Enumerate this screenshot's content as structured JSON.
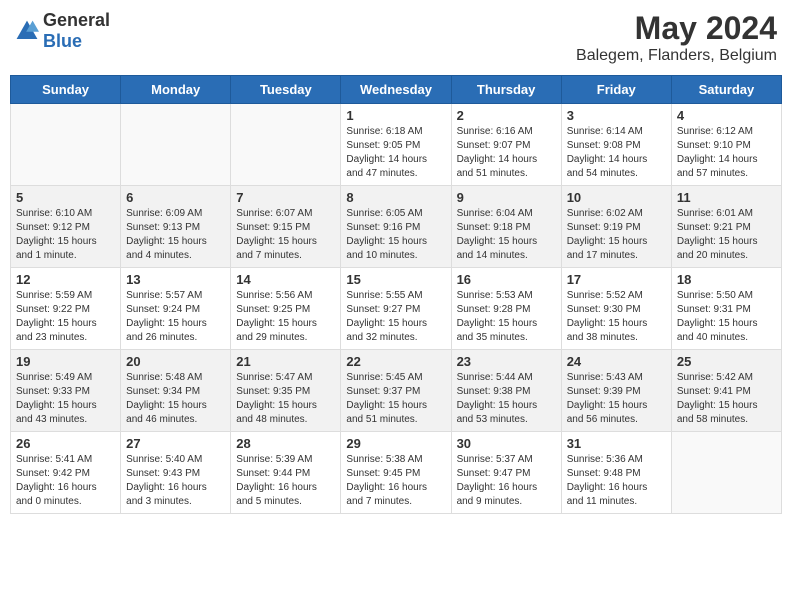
{
  "header": {
    "logo_general": "General",
    "logo_blue": "Blue",
    "month": "May 2024",
    "location": "Balegem, Flanders, Belgium"
  },
  "weekdays": [
    "Sunday",
    "Monday",
    "Tuesday",
    "Wednesday",
    "Thursday",
    "Friday",
    "Saturday"
  ],
  "weeks": [
    [
      {
        "day": "",
        "info": ""
      },
      {
        "day": "",
        "info": ""
      },
      {
        "day": "",
        "info": ""
      },
      {
        "day": "1",
        "info": "Sunrise: 6:18 AM\nSunset: 9:05 PM\nDaylight: 14 hours\nand 47 minutes."
      },
      {
        "day": "2",
        "info": "Sunrise: 6:16 AM\nSunset: 9:07 PM\nDaylight: 14 hours\nand 51 minutes."
      },
      {
        "day": "3",
        "info": "Sunrise: 6:14 AM\nSunset: 9:08 PM\nDaylight: 14 hours\nand 54 minutes."
      },
      {
        "day": "4",
        "info": "Sunrise: 6:12 AM\nSunset: 9:10 PM\nDaylight: 14 hours\nand 57 minutes."
      }
    ],
    [
      {
        "day": "5",
        "info": "Sunrise: 6:10 AM\nSunset: 9:12 PM\nDaylight: 15 hours\nand 1 minute."
      },
      {
        "day": "6",
        "info": "Sunrise: 6:09 AM\nSunset: 9:13 PM\nDaylight: 15 hours\nand 4 minutes."
      },
      {
        "day": "7",
        "info": "Sunrise: 6:07 AM\nSunset: 9:15 PM\nDaylight: 15 hours\nand 7 minutes."
      },
      {
        "day": "8",
        "info": "Sunrise: 6:05 AM\nSunset: 9:16 PM\nDaylight: 15 hours\nand 10 minutes."
      },
      {
        "day": "9",
        "info": "Sunrise: 6:04 AM\nSunset: 9:18 PM\nDaylight: 15 hours\nand 14 minutes."
      },
      {
        "day": "10",
        "info": "Sunrise: 6:02 AM\nSunset: 9:19 PM\nDaylight: 15 hours\nand 17 minutes."
      },
      {
        "day": "11",
        "info": "Sunrise: 6:01 AM\nSunset: 9:21 PM\nDaylight: 15 hours\nand 20 minutes."
      }
    ],
    [
      {
        "day": "12",
        "info": "Sunrise: 5:59 AM\nSunset: 9:22 PM\nDaylight: 15 hours\nand 23 minutes."
      },
      {
        "day": "13",
        "info": "Sunrise: 5:57 AM\nSunset: 9:24 PM\nDaylight: 15 hours\nand 26 minutes."
      },
      {
        "day": "14",
        "info": "Sunrise: 5:56 AM\nSunset: 9:25 PM\nDaylight: 15 hours\nand 29 minutes."
      },
      {
        "day": "15",
        "info": "Sunrise: 5:55 AM\nSunset: 9:27 PM\nDaylight: 15 hours\nand 32 minutes."
      },
      {
        "day": "16",
        "info": "Sunrise: 5:53 AM\nSunset: 9:28 PM\nDaylight: 15 hours\nand 35 minutes."
      },
      {
        "day": "17",
        "info": "Sunrise: 5:52 AM\nSunset: 9:30 PM\nDaylight: 15 hours\nand 38 minutes."
      },
      {
        "day": "18",
        "info": "Sunrise: 5:50 AM\nSunset: 9:31 PM\nDaylight: 15 hours\nand 40 minutes."
      }
    ],
    [
      {
        "day": "19",
        "info": "Sunrise: 5:49 AM\nSunset: 9:33 PM\nDaylight: 15 hours\nand 43 minutes."
      },
      {
        "day": "20",
        "info": "Sunrise: 5:48 AM\nSunset: 9:34 PM\nDaylight: 15 hours\nand 46 minutes."
      },
      {
        "day": "21",
        "info": "Sunrise: 5:47 AM\nSunset: 9:35 PM\nDaylight: 15 hours\nand 48 minutes."
      },
      {
        "day": "22",
        "info": "Sunrise: 5:45 AM\nSunset: 9:37 PM\nDaylight: 15 hours\nand 51 minutes."
      },
      {
        "day": "23",
        "info": "Sunrise: 5:44 AM\nSunset: 9:38 PM\nDaylight: 15 hours\nand 53 minutes."
      },
      {
        "day": "24",
        "info": "Sunrise: 5:43 AM\nSunset: 9:39 PM\nDaylight: 15 hours\nand 56 minutes."
      },
      {
        "day": "25",
        "info": "Sunrise: 5:42 AM\nSunset: 9:41 PM\nDaylight: 15 hours\nand 58 minutes."
      }
    ],
    [
      {
        "day": "26",
        "info": "Sunrise: 5:41 AM\nSunset: 9:42 PM\nDaylight: 16 hours\nand 0 minutes."
      },
      {
        "day": "27",
        "info": "Sunrise: 5:40 AM\nSunset: 9:43 PM\nDaylight: 16 hours\nand 3 minutes."
      },
      {
        "day": "28",
        "info": "Sunrise: 5:39 AM\nSunset: 9:44 PM\nDaylight: 16 hours\nand 5 minutes."
      },
      {
        "day": "29",
        "info": "Sunrise: 5:38 AM\nSunset: 9:45 PM\nDaylight: 16 hours\nand 7 minutes."
      },
      {
        "day": "30",
        "info": "Sunrise: 5:37 AM\nSunset: 9:47 PM\nDaylight: 16 hours\nand 9 minutes."
      },
      {
        "day": "31",
        "info": "Sunrise: 5:36 AM\nSunset: 9:48 PM\nDaylight: 16 hours\nand 11 minutes."
      },
      {
        "day": "",
        "info": ""
      }
    ]
  ]
}
